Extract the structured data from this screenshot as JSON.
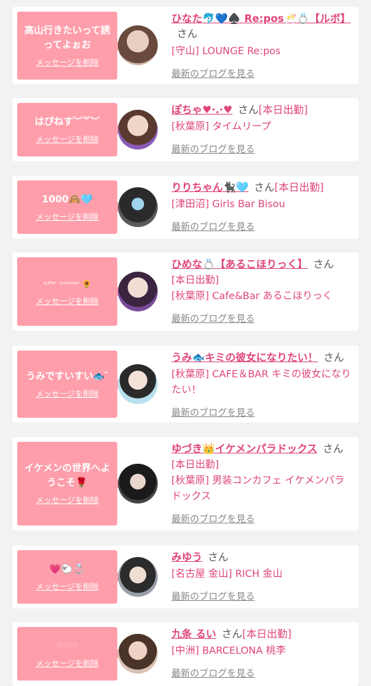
{
  "delete_label": "メッセージを削除",
  "blog_label": "最新のブログを見る",
  "san_label": "さん",
  "colors": {
    "bubble": "#ff9eab",
    "accent": "#e0457a",
    "muted": "#888888",
    "bg": "#f2f2f2"
  },
  "items": [
    {
      "message": "高山行きたいって誘ってよぉお",
      "name": "ひなた🐬💙♠️ Re:pos🥂💍【ルボ】",
      "tag": "",
      "shop": "[守山] LOUNGE Re:pos"
    },
    {
      "message": "はぴねす︶꒳︶",
      "name": "ぽちゃ♥·.·♥",
      "tag": "[本日出勤]",
      "shop": "[秋葉原] タイムリープ"
    },
    {
      "message": "1000🙈🩵",
      "name": "りりちゃん🐈‍⬛🩵",
      "tag": "[本日出勤]",
      "shop": "[津田沼] Girls Bar Bisou"
    },
    {
      "message": "ˢᵘᴾᵉʳ ˢᵘᵐᵐᵉʳ 🌻",
      "name": "ひめな💍【あるこほりっく】",
      "tag": "[本日出勤]",
      "shop": "[秋葉原] Cafe&Bar あるこほりっく"
    },
    {
      "message": "うみですいすい🐟 ̄",
      "name": "うみ🐟キミの彼女になりたい！",
      "tag": "",
      "shop": "[秋葉原] CAFE＆BAR キミの彼女になりたい！"
    },
    {
      "message": "イケメンの世界へようこそ🌹",
      "name": "ゆづき👑イケメンパラドックス",
      "tag": "[本日出勤]",
      "shop": "[秋葉原] 男装コンカフェ イケメンパラドックス"
    },
    {
      "message": "💗🐑💍",
      "name": "みゆう",
      "tag": "",
      "shop": "[名古屋 金山] RICH 金山"
    },
    {
      "message": "♡♡♡",
      "name": "九条 るい",
      "tag": "[本日出勤]",
      "shop": "[中洲] BARCELONA 桃李"
    }
  ]
}
